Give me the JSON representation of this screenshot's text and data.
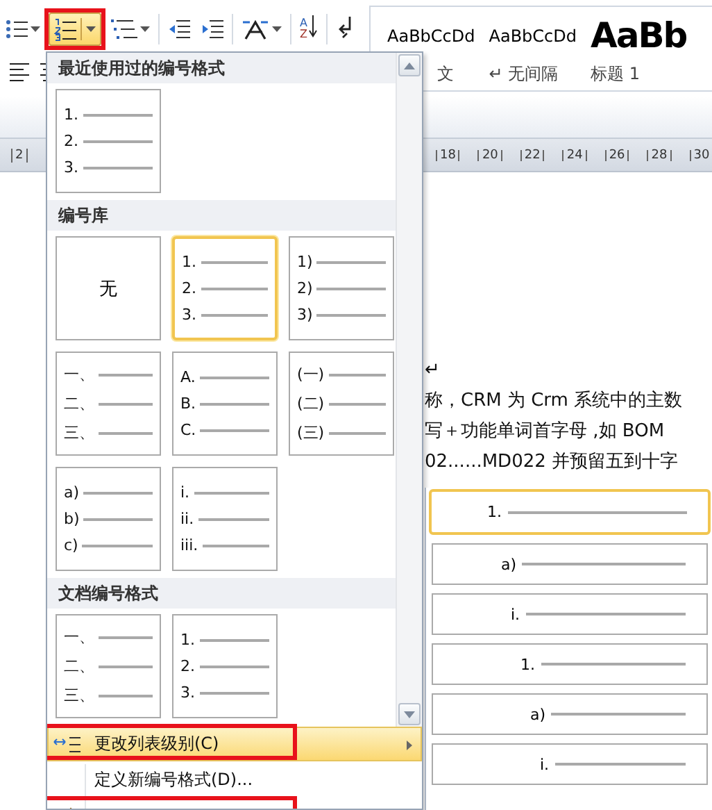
{
  "toolbar": {
    "numbering_button": {
      "selected": true,
      "callout": true
    },
    "sort_letters": [
      "A",
      "Z"
    ]
  },
  "styles_gallery": [
    {
      "kind": "normal",
      "sample": "AaBbCcDd",
      "label": "文"
    },
    {
      "kind": "normal",
      "sample": "AaBbCcDd",
      "label": "↵ 无间隔"
    },
    {
      "kind": "heading",
      "sample": "AaBb",
      "label": "标题 1"
    }
  ],
  "ruler": {
    "left_ticks": [
      "2"
    ],
    "right_ticks": [
      "18",
      "20",
      "22",
      "24",
      "26",
      "28",
      "30"
    ]
  },
  "document": {
    "lines": [
      "↵",
      "称，CRM 为 Crm 系统中的主数",
      "写＋功能单词首字母 ,如 BOM",
      "02......MD022 并预留五到十字"
    ]
  },
  "numbering_menu": {
    "sections": [
      {
        "title": "最近使用过的编号格式",
        "formats": [
          {
            "kind": "list",
            "markers": [
              "1.",
              "2.",
              "3."
            ],
            "selected": false
          }
        ]
      },
      {
        "title": "编号库",
        "formats": [
          {
            "kind": "none",
            "label": "无",
            "selected": false
          },
          {
            "kind": "list",
            "markers": [
              "1.",
              "2.",
              "3."
            ],
            "selected": true
          },
          {
            "kind": "list",
            "markers": [
              "1)",
              "2)",
              "3)"
            ],
            "selected": false
          },
          {
            "kind": "list",
            "markers": [
              "一、",
              "二、",
              "三、"
            ],
            "selected": false
          },
          {
            "kind": "list",
            "markers": [
              "A.",
              "B.",
              "C."
            ],
            "selected": false
          },
          {
            "kind": "list",
            "markers": [
              "(一)",
              "(二)",
              "(三)"
            ],
            "selected": false
          },
          {
            "kind": "list",
            "markers": [
              "a)",
              "b)",
              "c)"
            ],
            "selected": false
          },
          {
            "kind": "list",
            "markers": [
              "i.",
              "ii.",
              "iii."
            ],
            "selected": false
          }
        ]
      },
      {
        "title": "文档编号格式",
        "formats": [
          {
            "kind": "list",
            "markers": [
              "一、",
              "二、",
              "三、"
            ],
            "selected": false
          },
          {
            "kind": "list",
            "markers": [
              "1.",
              "2.",
              "3."
            ],
            "selected": false
          }
        ]
      }
    ],
    "commands": [
      {
        "kind": "levels",
        "label": "更改列表级别(C)",
        "highlighted": true,
        "submenu": true,
        "callout": true
      },
      {
        "kind": "define",
        "label": "定义新编号格式(D)...",
        "highlighted": false,
        "submenu": false,
        "callout": false
      },
      {
        "kind": "value",
        "highlighted": false,
        "submenu": false,
        "callout": true
      }
    ]
  },
  "list_levels": [
    {
      "marker": "1.",
      "selected": true
    },
    {
      "marker": "a)",
      "selected": false
    },
    {
      "marker": "i.",
      "selected": false
    },
    {
      "marker": "1.",
      "selected": false
    },
    {
      "marker": "a)",
      "selected": false
    },
    {
      "marker": "i.",
      "selected": false
    }
  ]
}
